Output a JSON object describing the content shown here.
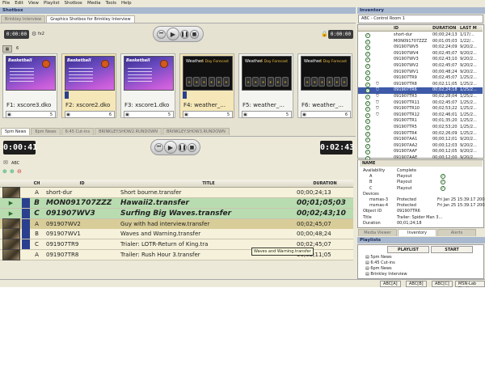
{
  "menu": [
    "File",
    "Edit",
    "View",
    "Playlist",
    "Shotbox",
    "Media",
    "Tools",
    "Help"
  ],
  "shotbox": {
    "panel_title": "Shotbox",
    "tabs": [
      "Brinkley Interview",
      "Graphics Shotbox for Brinkley Interview"
    ],
    "timecode_left": "0:00:00",
    "fx_label": "fx2",
    "timecode_right": "0:00:00",
    "count_label": "6",
    "thumbs": [
      {
        "name": "F1: xscore3.dko",
        "number": "5",
        "kind": "bball",
        "title": "Basketball",
        "selected": false
      },
      {
        "name": "F2: xscore2.dko",
        "number": "6",
        "kind": "bball",
        "title": "Basketball",
        "selected": true
      },
      {
        "name": "F3: xscore1.dko",
        "number": "5",
        "kind": "bball",
        "title": "Basketball",
        "selected": false
      },
      {
        "name": "F4: weather_...",
        "number": "5",
        "kind": "weather",
        "title": "Weather",
        "subtitle": "6 Day Forecast",
        "selected": true
      },
      {
        "name": "F5: weather_...",
        "number": "5",
        "kind": "weather",
        "title": "Weather",
        "subtitle": "6 Day Forecast",
        "selected": false
      },
      {
        "name": "F6: weather_...",
        "number": "6",
        "kind": "weather",
        "title": "Weather",
        "subtitle": "6 Day Forecast",
        "selected": false
      }
    ]
  },
  "playlist": {
    "tabs": [
      "5pm News",
      "6pm News",
      "6:45 Cut-ins",
      "BRINKLEY.SHOW2.RUNDOWN",
      "BRINKLEY.SHOW3.RUNDOWN"
    ],
    "timecode_left": "0:00:41",
    "timecode_right": "0:02:43",
    "channel_label": "ABC",
    "columns": [
      "CH",
      "ID",
      "TITLE",
      "DURATION"
    ],
    "rows": [
      {
        "ch": "A",
        "id": "short-dur",
        "title": "Short bourne.transfer",
        "duration": "00;00;24;13",
        "style": "plain"
      },
      {
        "ch": "B",
        "id": "MON091707ZZZ",
        "title": "Hawaii2.transfer",
        "duration": "00;01;05;03",
        "style": "green-big"
      },
      {
        "ch": "C",
        "id": "091907WV3",
        "title": "Surfing Big Waves.transfer",
        "duration": "00;02;43;10",
        "style": "green-big"
      },
      {
        "ch": "A",
        "id": "091907WV2",
        "title": "Guy with had interview.transfer",
        "duration": "00;02;45;07",
        "style": "current"
      },
      {
        "ch": "B",
        "id": "091907WV1",
        "title": "Waves and Warning.transfer",
        "duration": "00;00;48;24",
        "style": "plain"
      },
      {
        "ch": "C",
        "id": "091907TR9",
        "title": "Trialer: LOTR-Return of King.tra",
        "duration": "00;02;45;07",
        "style": "plain"
      },
      {
        "ch": "A",
        "id": "091907TR8",
        "title": "Trailer: Rush Hour 3.transfer",
        "duration": "00;02;11;05",
        "style": "plain"
      }
    ],
    "tooltip": "Waves and Warning.transfer"
  },
  "inventory": {
    "panel_title": "Inventory",
    "subtitle": "ABC - Control Room 1",
    "columns": [
      "ID",
      "DURATION",
      "LAST M"
    ],
    "rows": [
      {
        "id": "short-dur",
        "duration": "00;00;24;13",
        "last": "1/17/..."
      },
      {
        "id": "MON091707ZZZ",
        "duration": "00;01;05;03",
        "last": "1/22/..."
      },
      {
        "id": "091907WV5",
        "duration": "00;02;24;09",
        "last": "9/20/2..."
      },
      {
        "id": "091907WV4",
        "duration": "00;02;45;07",
        "last": "9/20/2..."
      },
      {
        "id": "091907WV3",
        "duration": "00;02;43;10",
        "last": "9/20/2..."
      },
      {
        "id": "091907WV2",
        "duration": "00;02;45;07",
        "last": "9/20/2..."
      },
      {
        "id": "091907WV1",
        "duration": "00;00;48;24",
        "last": "9/20/2..."
      },
      {
        "id": "091907TR9",
        "duration": "00;02;45;07",
        "last": "1/25/2..."
      },
      {
        "id": "091907TR8",
        "duration": "00;02;11;05",
        "last": "1/25/2..."
      },
      {
        "id": "091907TR6",
        "duration": "00;02;24;18",
        "last": "1/25/2..."
      },
      {
        "id": "091907TR3",
        "duration": "00;02;28;04",
        "last": "1/25/2..."
      },
      {
        "id": "091907TR11",
        "duration": "00;02;45;07",
        "last": "1/25/2..."
      },
      {
        "id": "091907TR10",
        "duration": "00;02;53;22",
        "last": "1/25/2..."
      },
      {
        "id": "091907TR12",
        "duration": "00;02;46;01",
        "last": "1/25/2..."
      },
      {
        "id": "091907TR1",
        "duration": "00;01;35;20",
        "last": "1/25/2..."
      },
      {
        "id": "091907TR5",
        "duration": "00;02;53;20",
        "last": "1/25/2..."
      },
      {
        "id": "091907TR4",
        "duration": "00;02;26;09",
        "last": "1/25/2..."
      },
      {
        "id": "091907AA1",
        "duration": "00;00;12;01",
        "last": "9/20/2..."
      },
      {
        "id": "091907AA2",
        "duration": "00;00;12;03",
        "last": "9/20/2..."
      },
      {
        "id": "091907AAF",
        "duration": "00;00;12;05",
        "last": "9/20/2..."
      },
      {
        "id": "091907AAE",
        "duration": "00;00;12;00",
        "last": "9/20/2..."
      },
      {
        "id": "091907AAD",
        "duration": "00;00;12;04",
        "last": "9/20/2..."
      }
    ],
    "selected_index": 9,
    "details_header": "NAME",
    "details": [
      {
        "label": "Availability",
        "value": "Complete"
      },
      {
        "label": "A",
        "value": "Playout"
      },
      {
        "label": "B",
        "value": "Playout"
      },
      {
        "label": "C",
        "value": "Playout"
      },
      {
        "label": "Devices",
        "value": ""
      },
      {
        "label": "msmas-3",
        "value": "Protected",
        "extra": "Fri Jan 25 15:39:17 2008"
      },
      {
        "label": "msmas-4",
        "value": "Protected",
        "extra": "Fri Jan 25 15:39:17 2008"
      },
      {
        "label": "Object ID",
        "value": "091907TR6"
      },
      {
        "label": "Title",
        "value": "Trailer: Spider Man 3..."
      },
      {
        "label": "Duration",
        "value": "00;01;24;18"
      }
    ],
    "bottom_tabs": [
      "Media Viewer",
      "Inventory",
      "Alerts"
    ]
  },
  "playlists": {
    "panel_title": "Playlists",
    "columns": [
      "PLAYLIST",
      "START"
    ],
    "items": [
      "5pm News",
      "6:45 Cut-ins",
      "6pm News",
      "Brinkley Interview"
    ]
  },
  "statusbar": [
    "ABC[A]",
    "ABC[B]",
    "ABC[C]",
    "MSN-Lab Studio"
  ]
}
